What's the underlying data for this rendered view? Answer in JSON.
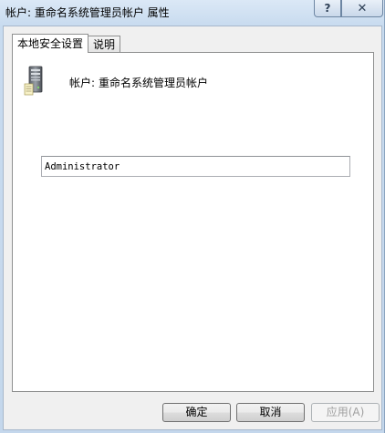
{
  "window": {
    "title": "帐户: 重命名系统管理员帐户 属性",
    "help_label": "?",
    "close_label": "✕"
  },
  "tabs": [
    {
      "label": "本地安全设置",
      "active": true
    },
    {
      "label": "说明",
      "active": false
    }
  ],
  "policy": {
    "icon": "server-icon",
    "prefix": "帐户:",
    "name": "重命名系统管理员帐户"
  },
  "field": {
    "value": "Administrator"
  },
  "buttons": {
    "ok": "确定",
    "cancel": "取消",
    "apply": "应用(A)"
  },
  "colors": {
    "title_bar": "#c8dbef",
    "panel": "#ffffff",
    "disabled_text": "#a0a0a0"
  }
}
